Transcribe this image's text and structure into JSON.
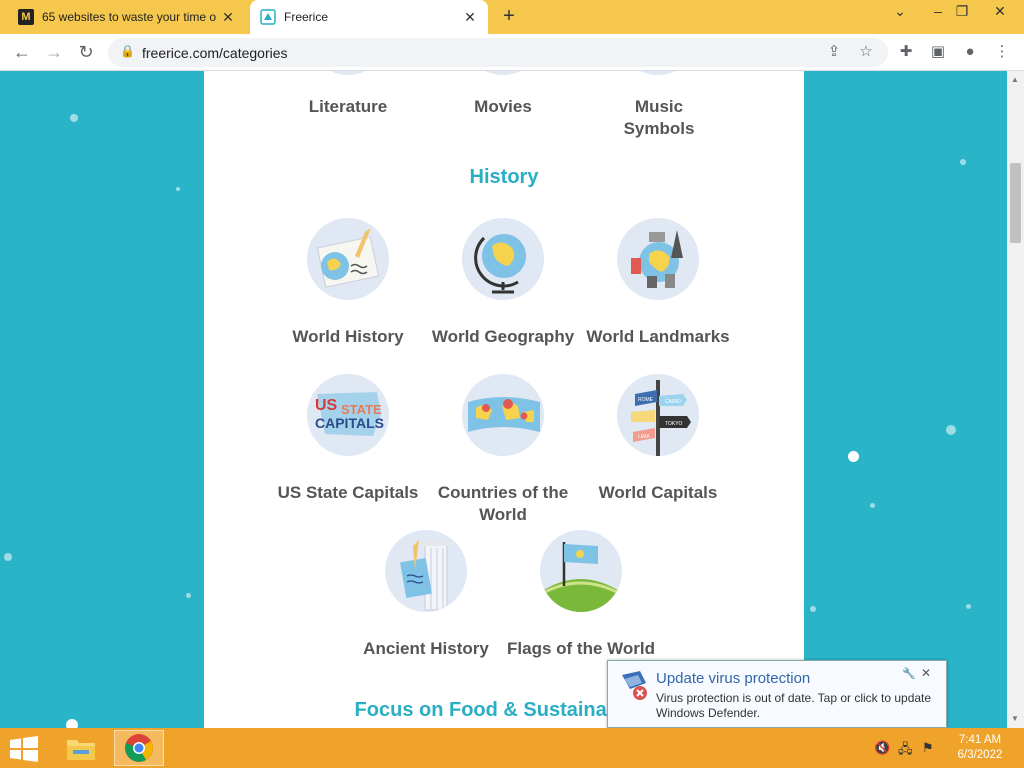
{
  "browser": {
    "tabs": [
      {
        "title": "65 websites to waste your time o",
        "favicon": "M",
        "active": false
      },
      {
        "title": "Freerice",
        "favicon": "freerice",
        "active": true
      }
    ],
    "url": "freerice.com/categories"
  },
  "page": {
    "top_row": [
      {
        "label": "Literature"
      },
      {
        "label": "Movies"
      },
      {
        "label": "Music Symbols"
      }
    ],
    "history_title": "History",
    "history_items": [
      {
        "label": "World History",
        "icon": "world-history-icon"
      },
      {
        "label": "World Geography",
        "icon": "globe-icon"
      },
      {
        "label": "World Landmarks",
        "icon": "landmarks-icon"
      },
      {
        "label": "US State Capitals",
        "icon": "us-state-capitals-icon",
        "icon_text_1": "US",
        "icon_text_2": "STATE",
        "icon_text_3": "CAPITALS"
      },
      {
        "label": "Countries of the World",
        "icon": "map-icon"
      },
      {
        "label": "World Capitals",
        "icon": "signpost-icon",
        "icon_text": [
          "ROME",
          "CAIRO",
          "TOKYO",
          "LIMA"
        ]
      },
      {
        "label": "Ancient History",
        "icon": "column-scroll-icon"
      },
      {
        "label": "Flags of the World",
        "icon": "flag-hill-icon"
      }
    ],
    "next_section_title": "Focus on Food & Sustainability"
  },
  "notification": {
    "title": "Update virus protection",
    "message": "Virus protection is out of date. Tap or click to update Windows Defender."
  },
  "taskbar": {
    "time": "7:41 AM",
    "date": "6/3/2022"
  },
  "colors": {
    "tab_strip": "#f5c84d",
    "background": "#2ab4c8",
    "section_title": "#29aec3",
    "taskbar": "#f0a32a"
  }
}
